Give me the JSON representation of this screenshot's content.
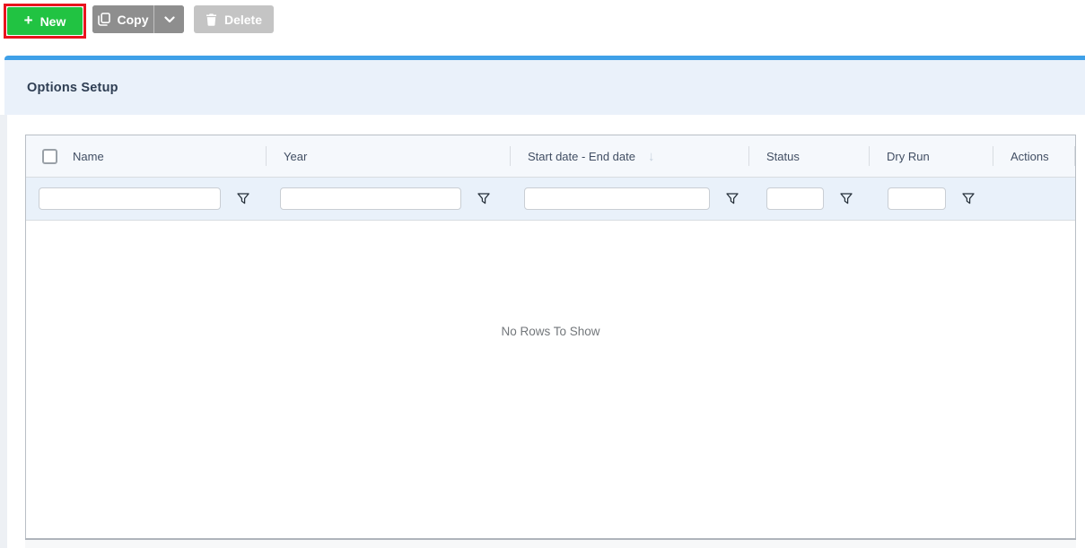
{
  "toolbar": {
    "new": {
      "label": "New",
      "icon": "plus-icon",
      "glyph": "+"
    },
    "copy": {
      "label": "Copy",
      "icon": "copy-icon"
    },
    "copy_more": {
      "icon": "chevron-down-icon"
    },
    "delete": {
      "label": "Delete",
      "icon": "trash-icon",
      "disabled": true
    }
  },
  "panel": {
    "title": "Options Setup"
  },
  "grid": {
    "columns": [
      {
        "label": "Name",
        "has_filter": true,
        "has_select_all_checkbox": true
      },
      {
        "label": "Year",
        "has_filter": true
      },
      {
        "label": "Start date - End date",
        "has_filter": true,
        "sort_icon": "arrow-down-icon",
        "sort_glyph": "↓"
      },
      {
        "label": "Status",
        "has_filter": true
      },
      {
        "label": "Dry Run",
        "has_filter": true
      },
      {
        "label": "Actions",
        "has_filter": false
      }
    ],
    "filter_values": [
      "",
      "",
      "",
      "",
      ""
    ],
    "filter_icon": "funnel-icon",
    "select_all_checked": false,
    "rows": [],
    "empty_message": "No Rows To Show"
  },
  "annotation": {
    "shape": "red-highlight-box",
    "target": "new-button",
    "color": "#e8141e"
  },
  "colors": {
    "accent_blue": "#3fa0e8",
    "panel_header_bg": "#eaf1fa",
    "new_button_green": "#21c342",
    "copy_button_gray": "#8e8e8e",
    "delete_button_gray": "#c4c4c4",
    "grid_header_bg": "#f5f8fc",
    "filter_row_bg": "#e9f1fa",
    "annotation_red": "#e8141e"
  }
}
